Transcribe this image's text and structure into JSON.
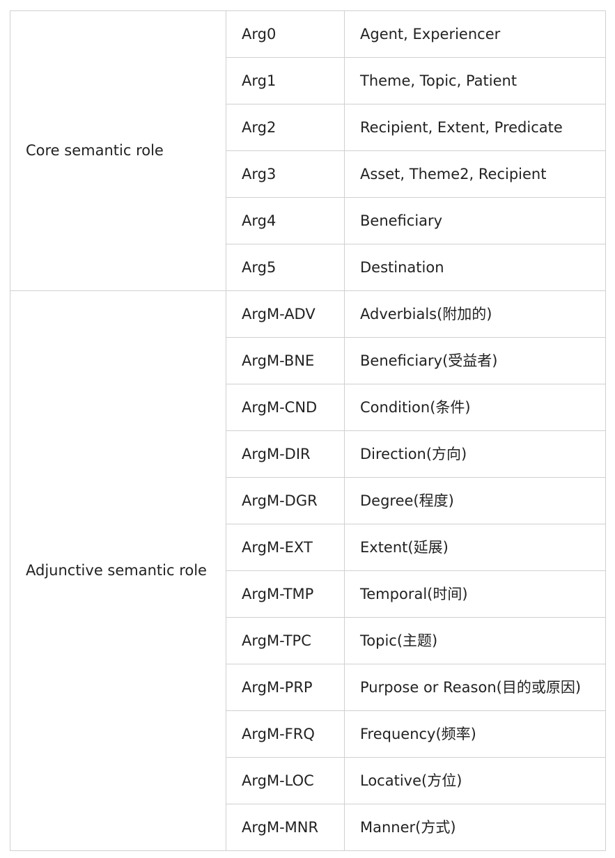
{
  "groups": [
    {
      "category": "Core semantic role",
      "rows": [
        {
          "label": "Arg0",
          "description": "Agent, Experiencer"
        },
        {
          "label": "Arg1",
          "description": "Theme, Topic, Patient"
        },
        {
          "label": "Arg2",
          "description": "Recipient, Extent, Predicate"
        },
        {
          "label": "Arg3",
          "description": "Asset, Theme2, Recipient"
        },
        {
          "label": "Arg4",
          "description": "Beneficiary"
        },
        {
          "label": "Arg5",
          "description": "Destination"
        }
      ]
    },
    {
      "category": "Adjunctive semantic role",
      "rows": [
        {
          "label": "ArgM-ADV",
          "description": "Adverbials(附加的)"
        },
        {
          "label": "ArgM-BNE",
          "description": "Beneficiary(受益者)"
        },
        {
          "label": "ArgM-CND",
          "description": "Condition(条件)"
        },
        {
          "label": "ArgM-DIR",
          "description": "Direction(方向)"
        },
        {
          "label": "ArgM-DGR",
          "description": "Degree(程度)"
        },
        {
          "label": "ArgM-EXT",
          "description": "Extent(延展)"
        },
        {
          "label": "ArgM-TMP",
          "description": "Temporal(时间)"
        },
        {
          "label": "ArgM-TPC",
          "description": "Topic(主题)"
        },
        {
          "label": "ArgM-PRP",
          "description": "Purpose or Reason(目的或原因)"
        },
        {
          "label": "ArgM-FRQ",
          "description": "Frequency(频率)"
        },
        {
          "label": "ArgM-LOC",
          "description": "Locative(方位)"
        },
        {
          "label": "ArgM-MNR",
          "description": "Manner(方式)"
        }
      ]
    }
  ]
}
